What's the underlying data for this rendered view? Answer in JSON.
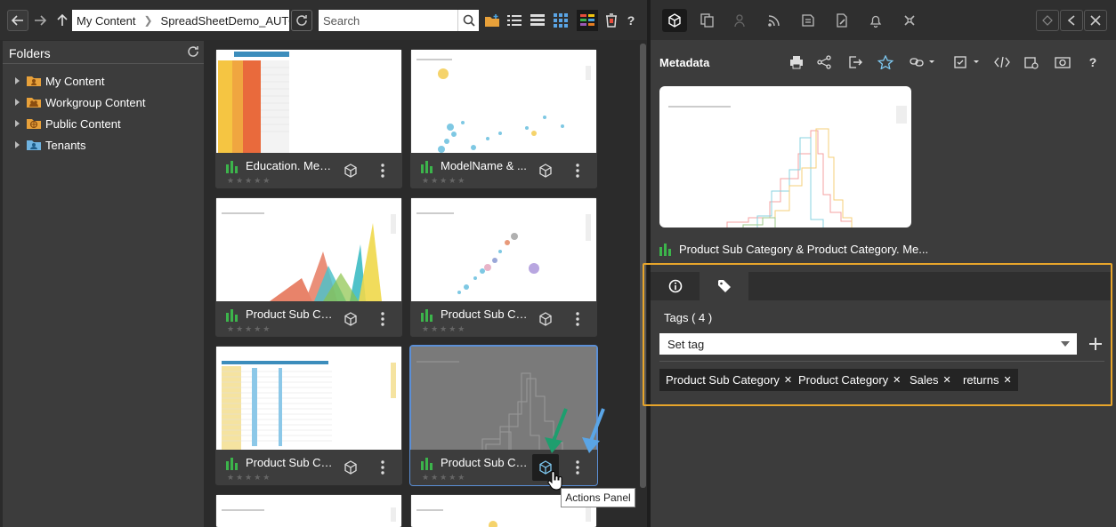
{
  "toolbar": {
    "breadcrumb": [
      "My Content",
      "SpreadSheetDemo_AUTO"
    ],
    "search_placeholder": "Search",
    "help": "?"
  },
  "folders": {
    "title": "Folders",
    "items": [
      {
        "label": "My Content",
        "icon": "my-content-folder-icon"
      },
      {
        "label": "Workgroup Content",
        "icon": "workgroup-folder-icon"
      },
      {
        "label": "Public Content",
        "icon": "public-folder-icon"
      },
      {
        "label": "Tenants",
        "icon": "tenants-folder-icon"
      }
    ]
  },
  "gallery": {
    "cards": [
      {
        "title": "Education. Meas...",
        "thumb": "table"
      },
      {
        "title": "ModelName & ...",
        "thumb": "scatter"
      },
      {
        "title": "Product Sub Cat...",
        "thumb": "area"
      },
      {
        "title": "Product Sub Cat...",
        "thumb": "scatter2"
      },
      {
        "title": "Product Sub Cat...",
        "thumb": "table2"
      },
      {
        "title": "Product Sub Cat...",
        "thumb": "histogram",
        "selected": true
      }
    ],
    "tooltip": "Actions Panel"
  },
  "right_panel": {
    "metadata_title": "Metadata",
    "help": "?",
    "report_title": "Product Sub Category & Product Category. Me...",
    "tags_label": "Tags ( 4 )",
    "set_tag_placeholder": "Set tag",
    "tags": [
      "Product Sub Category",
      "Product Category",
      "Sales",
      "returns"
    ]
  },
  "colors": {
    "accent_highlight": "#e7a52b",
    "selected_card": "#5b8fd6",
    "chart_icon_green": "#3cb44b",
    "arrow_green": "#1e9e6e",
    "arrow_blue": "#5aa5e6"
  }
}
